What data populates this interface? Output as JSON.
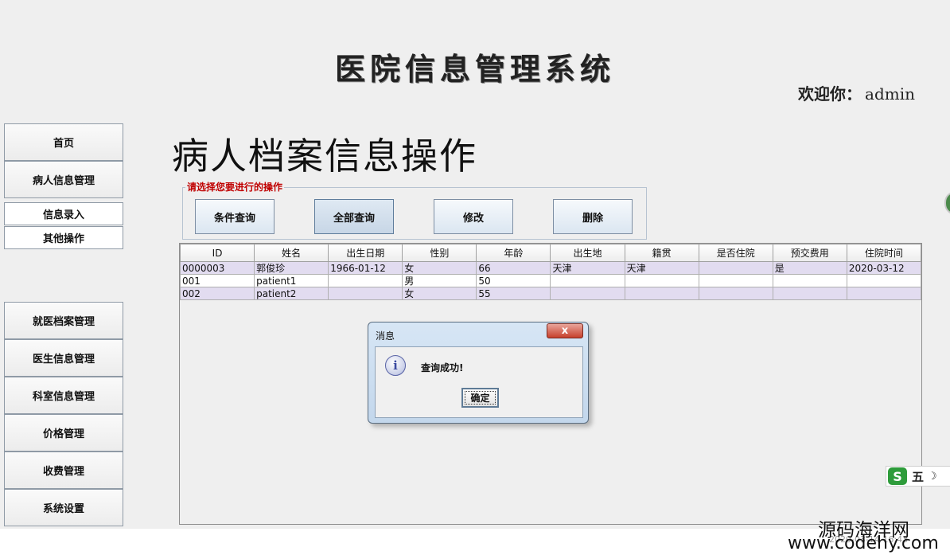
{
  "header": {
    "app_title": "医院信息管理系统",
    "welcome_prefix": "欢迎你：",
    "username": "admin"
  },
  "sidebar": {
    "home": "首页",
    "patient_info_mgmt": "病人信息管理",
    "sub_items": [
      "信息录入",
      "其他操作"
    ],
    "modules": [
      "就医档案管理",
      "医生信息管理",
      "科室信息管理",
      "价格管理",
      "收费管理",
      "系统设置"
    ]
  },
  "main": {
    "page_heading": "病人档案信息操作",
    "operation_legend": "请选择您要进行的操作",
    "buttons": {
      "conditional_query": "条件查询",
      "query_all": "全部查询",
      "modify": "修改",
      "delete": "删除"
    },
    "table": {
      "columns": [
        "ID",
        "姓名",
        "出生日期",
        "性别",
        "年龄",
        "出生地",
        "籍贯",
        "是否住院",
        "预交费用",
        "住院时间"
      ],
      "rows": [
        [
          "0000003",
          "郭俊珍",
          "1966-01-12",
          "女",
          "66",
          "天津",
          "天津",
          "",
          "是",
          "2020-03-12"
        ],
        [
          "001",
          "patient1",
          "",
          "男",
          "50",
          "",
          "",
          "",
          "",
          ""
        ],
        [
          "002",
          "patient2",
          "",
          "女",
          "55",
          "",
          "",
          "",
          "",
          ""
        ]
      ]
    }
  },
  "dialog": {
    "title": "消息",
    "message": "查询成功!",
    "ok_label": "确定",
    "close_glyph": "x"
  },
  "ime": {
    "logo": "S",
    "mode": "五",
    "moon": "☽"
  },
  "watermark": {
    "line1": "源码海洋网",
    "line2": "www.codehy.com",
    "timestamp": "2020-03-14 16:43"
  }
}
